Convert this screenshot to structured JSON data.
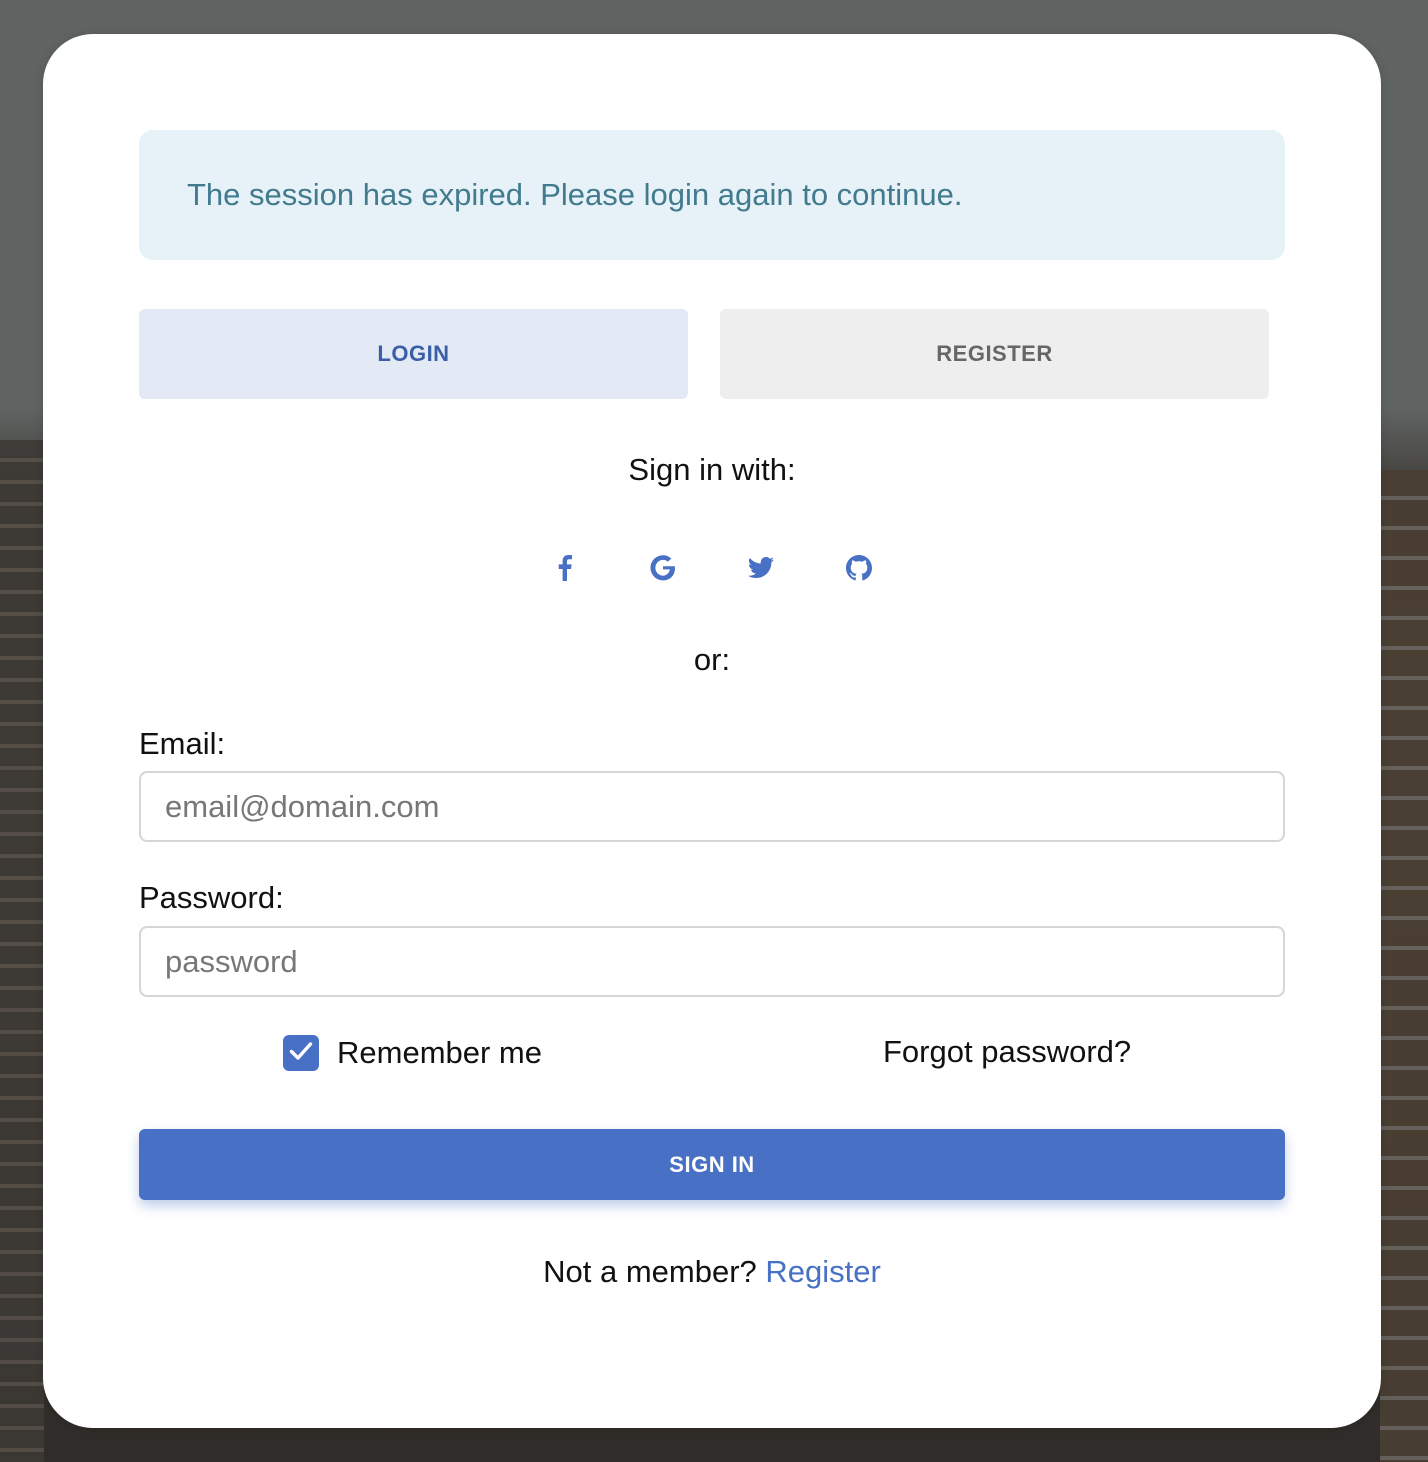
{
  "alert": {
    "message": "The session has expired. Please login again to continue."
  },
  "tabs": [
    {
      "label": "LOGIN",
      "active": true
    },
    {
      "label": "REGISTER",
      "active": false
    }
  ],
  "social": {
    "heading": "Sign in with:",
    "providers": [
      "facebook-icon",
      "google-icon",
      "twitter-icon",
      "github-icon"
    ],
    "icon_color": "#4870c4"
  },
  "divider_text": "or:",
  "form": {
    "email_label": "Email:",
    "email_placeholder": "email@domain.com",
    "email_value": "",
    "password_label": "Password:",
    "password_placeholder": "password",
    "password_value": "",
    "remember_label": "Remember me",
    "remember_checked": true,
    "forgot_label": "Forgot password?",
    "submit_label": "SIGN IN"
  },
  "footer": {
    "prompt": "Not a member?",
    "link_label": "Register"
  },
  "colors": {
    "accent": "#4870c4",
    "alert_bg": "#e6f2f8",
    "alert_text": "#427a8e"
  }
}
